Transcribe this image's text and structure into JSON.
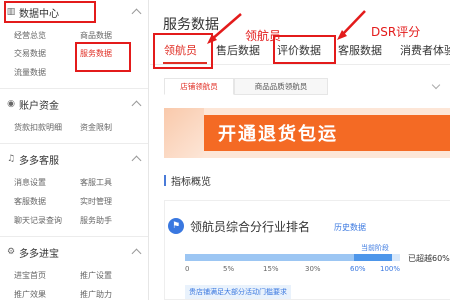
{
  "sidebar": {
    "sections": [
      {
        "title": "数据中心",
        "icon": "bar-chart-icon",
        "items": [
          "经营总览",
          "商品数据",
          "交易数据",
          "服务数据",
          "流量数据"
        ],
        "active": "服务数据"
      },
      {
        "title": "账户资金",
        "icon": "target-icon",
        "items": [
          "货款扣款明细",
          "资金限制"
        ]
      },
      {
        "title": "多多客服",
        "icon": "headset-icon",
        "items": [
          "消息设置",
          "客服工具",
          "客服数据",
          "实时管理",
          "聊天记录查询",
          "服务助手"
        ]
      },
      {
        "title": "多多进宝",
        "icon": "gear-icon",
        "items": [
          "进宝首页",
          "推广设置",
          "推广效果",
          "推广助力"
        ]
      }
    ]
  },
  "main": {
    "title": "服务数据",
    "tabs": [
      "领航员",
      "售后数据",
      "评价数据",
      "客服数据",
      "消费者体验"
    ],
    "active_tab": "领航员",
    "annotations": {
      "navigator": "领航员",
      "dsr": "DSR评分"
    },
    "subtabs": [
      "店铺领航员",
      "商品品质领航员"
    ],
    "banner_text": "开通退货包运",
    "section_title": "指标概览",
    "card": {
      "title": "领航员综合分行业排名",
      "history_link": "历史数据",
      "current_stage_label": "当前阶段",
      "ticks": [
        "0",
        "5%",
        "15%",
        "30%",
        "60%",
        "100%"
      ],
      "current_stage_value": 60,
      "exceed_text": "已超越60%",
      "tip_pill": "贵店铺满足大部分活动门槛要求"
    }
  },
  "colors": {
    "accent": "#e02e24",
    "annotation_red": "#e31b1b",
    "blue": "#3a78e0"
  }
}
